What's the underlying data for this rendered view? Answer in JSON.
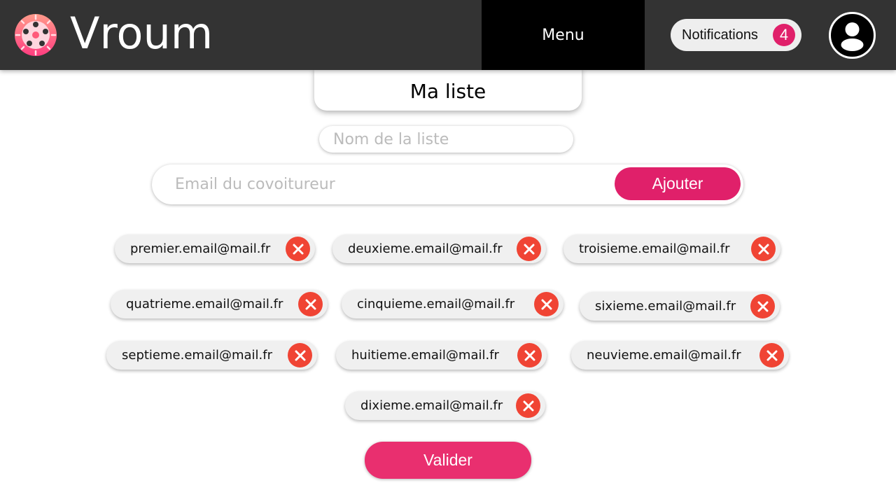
{
  "header": {
    "brand": "Vroum",
    "menu_label": "Menu",
    "notifications_label": "Notifications",
    "notifications_count": "4"
  },
  "list": {
    "title": "Ma liste",
    "name_placeholder": "Nom de la liste",
    "email_placeholder": "Email du covoitureur",
    "add_label": "Ajouter",
    "submit_label": "Valider"
  },
  "emails": [
    "premier.email@mail.fr",
    "deuxieme.email@mail.fr",
    "troisieme.email@mail.fr",
    "quatrieme.email@mail.fr",
    "cinquieme.email@mail.fr",
    "sixieme.email@mail.fr",
    "septieme.email@mail.fr",
    "huitieme.email@mail.fr",
    "neuvieme.email@mail.fr",
    "dixieme.email@mail.fr"
  ],
  "colors": {
    "accent": "#e0206a",
    "remove": "#f04434",
    "header": "#333333"
  }
}
